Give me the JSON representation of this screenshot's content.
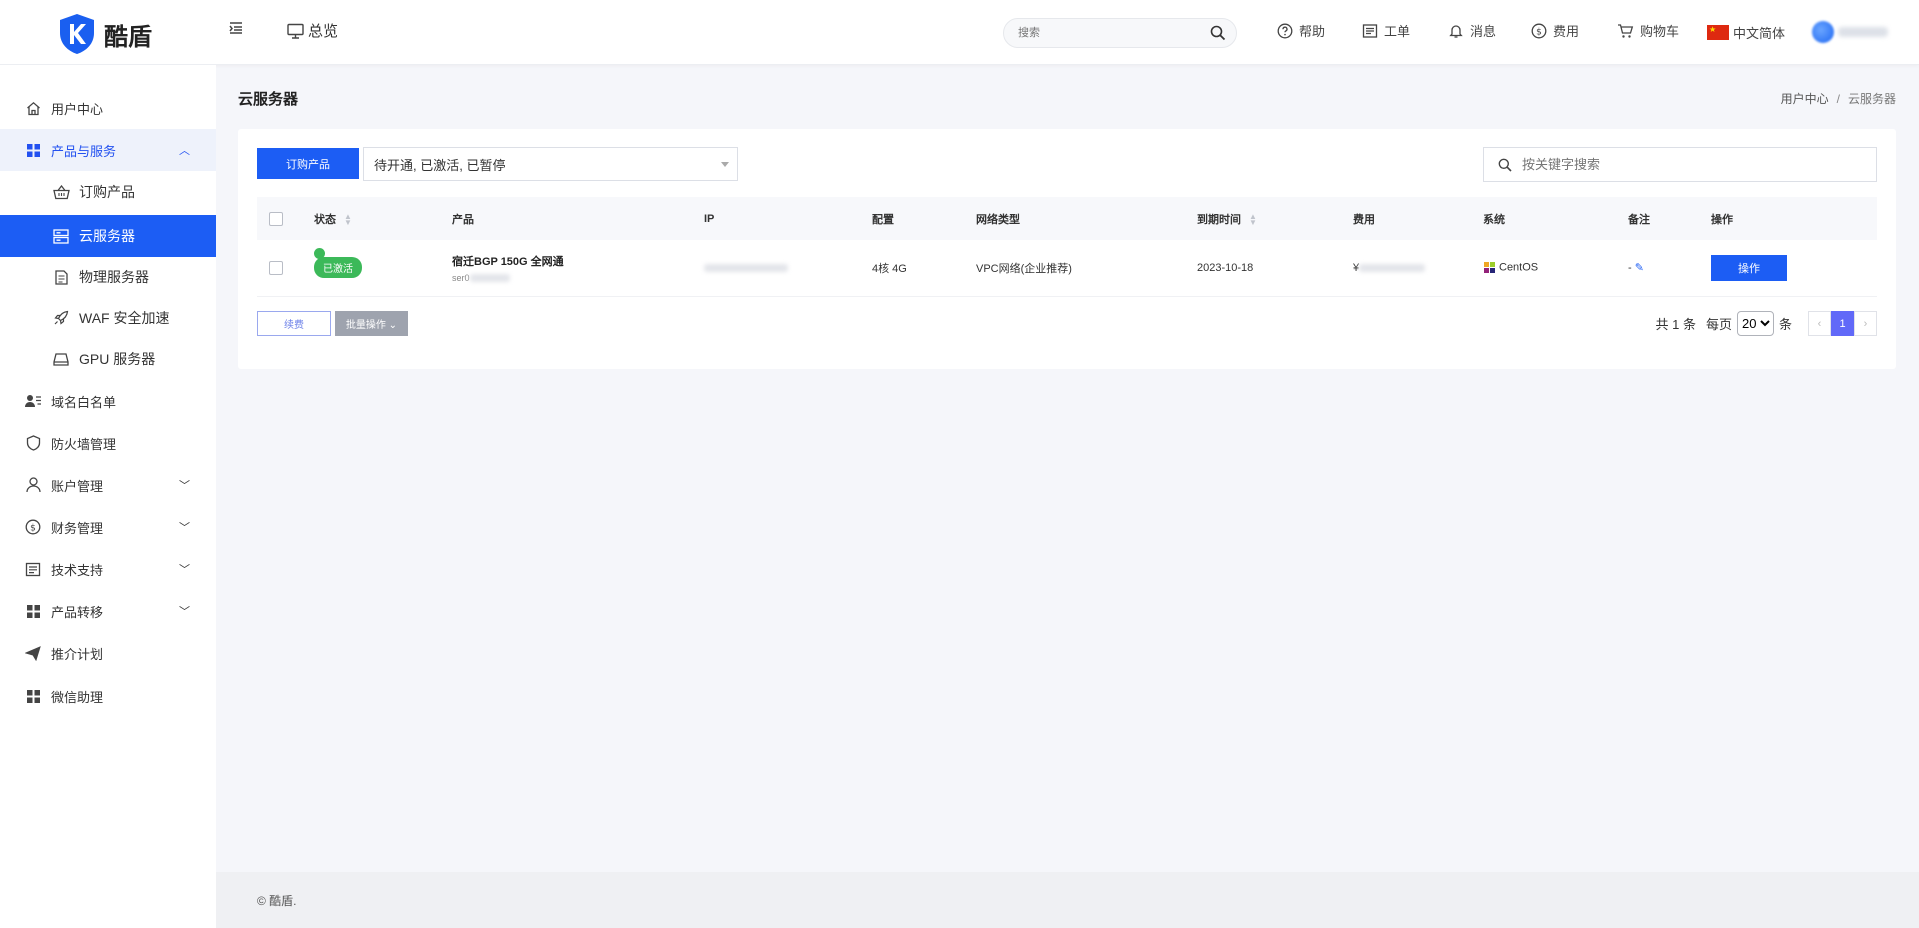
{
  "brand": {
    "name": "酷盾"
  },
  "topbar": {
    "overview": "总览",
    "search_placeholder": "搜索",
    "help": "帮助",
    "ticket": "工单",
    "message": "消息",
    "fee": "费用",
    "cart": "购物车",
    "language": "中文简体"
  },
  "sidebar": {
    "user_center": "用户中心",
    "products_services": "产品与服务",
    "sub_order": "订购产品",
    "sub_cloud": "云服务器",
    "sub_physical": "物理服务器",
    "sub_waf": "WAF 安全加速",
    "sub_gpu": "GPU 服务器",
    "domain_whitelist": "域名白名单",
    "firewall": "防火墙管理",
    "account": "账户管理",
    "finance": "财务管理",
    "support": "技术支持",
    "transfer": "产品转移",
    "referral": "推介计划",
    "wechat": "微信助理"
  },
  "page": {
    "title": "云服务器",
    "breadcrumb_home": "用户中心",
    "breadcrumb_sep": "/",
    "breadcrumb_current": "云服务器"
  },
  "toolbar": {
    "order_button": "订购产品",
    "filter_value": "待开通, 已激活, 已暂停",
    "keyword_placeholder": "按关键字搜索"
  },
  "table": {
    "headers": {
      "status": "状态",
      "product": "产品",
      "ip": "IP",
      "config": "配置",
      "network": "网络类型",
      "expire": "到期时间",
      "fee": "费用",
      "os": "系统",
      "remark": "备注",
      "action": "操作"
    },
    "rows": [
      {
        "status": "已激活",
        "product_name": "宿迁BGP 150G 全网通",
        "product_id_prefix": "ser0",
        "config": "4核 4G",
        "network": "VPC网络(企业推荐)",
        "expire": "2023-10-18",
        "fee_prefix": "¥",
        "os": "CentOS",
        "remark": "-",
        "action": "操作"
      }
    ]
  },
  "footer_actions": {
    "renew": "续费",
    "batch": "批量操作 ⌄"
  },
  "pager": {
    "total": "共 1 条",
    "per_page": "每页",
    "per_page_value": "20",
    "unit": "条",
    "prev": "‹",
    "current": "1",
    "next": "›"
  },
  "footer": {
    "copyright": "© 酷盾."
  },
  "colors": {
    "primary": "#1c5df4",
    "success": "#3cb959",
    "page_bg": "#f5f6fa"
  }
}
